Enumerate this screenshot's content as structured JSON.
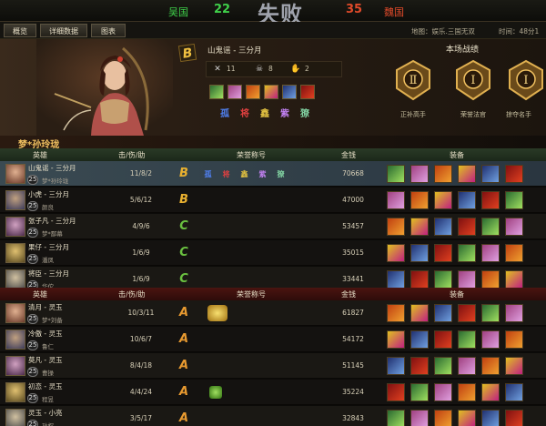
{
  "score": {
    "team_left": "吴国",
    "score_left": "22",
    "result_title": "失败",
    "score_right": "35",
    "team_right": "魏国"
  },
  "tabs": [
    "概览",
    "详细数据",
    "图表"
  ],
  "map_info": "地图：娱乐.三国无双",
  "time_info": "时间：48分1",
  "hero_banner": {
    "grade": "B",
    "hero_title": "山鬼谣 - 三分月",
    "kills": "11",
    "deaths": "8",
    "assists": "2",
    "honor_header": "本场战绩",
    "medals": [
      "正补高手",
      "荣誉法官",
      "掠夺名手"
    ]
  },
  "player_name": "梦*孙玲珑",
  "table_headers": {
    "hero": "英雄",
    "kda": "击/伤/助",
    "honor": "荣誉称号",
    "gold": "金钱",
    "items": "装备"
  },
  "team1": [
    {
      "hero": "山鬼谣 - 三分月",
      "level": "25",
      "player": "梦*孙玲珑",
      "kda": "11/8/2",
      "grade": "B",
      "gold": "70668",
      "selected": true
    },
    {
      "hero": "小虎 - 三分月",
      "level": "25",
      "player": "颜良",
      "kda": "5/6/12",
      "grade": "B",
      "gold": "47000"
    },
    {
      "hero": "张子凡 - 三分月",
      "level": "25",
      "player": "梦*鄙幕",
      "kda": "4/9/6",
      "grade": "C",
      "gold": "53457"
    },
    {
      "hero": "果仔 - 三分月",
      "level": "25",
      "player": "潘凤",
      "kda": "1/6/9",
      "grade": "C",
      "gold": "35015"
    },
    {
      "hero": "将臣 - 三分月",
      "level": "25",
      "player": "华佗",
      "kda": "1/6/9",
      "grade": "C",
      "gold": "33441"
    }
  ],
  "team2": [
    {
      "hero": "清月 - 灵玉",
      "level": "25",
      "player": "梦*刘备",
      "kda": "10/3/11",
      "grade": "A",
      "gold": "61827"
    },
    {
      "hero": "冷傲 - 灵玉",
      "level": "25",
      "player": "鲁仁",
      "kda": "10/6/7",
      "grade": "A",
      "gold": "54172"
    },
    {
      "hero": "莫凡 - 灵玉",
      "level": "25",
      "player": "曹操",
      "kda": "8/4/18",
      "grade": "A",
      "gold": "51145"
    },
    {
      "hero": "初恋 - 灵玉",
      "level": "25",
      "player": "程昱",
      "kda": "4/4/24",
      "grade": "A",
      "gold": "35224"
    },
    {
      "hero": "灵玉 - 小亮",
      "level": "25",
      "player": "孙权",
      "kda": "3/5/17",
      "grade": "A",
      "gold": "32843"
    }
  ],
  "honor_glyphs": [
    "孤",
    "将",
    "鑫",
    "紫",
    "獠"
  ],
  "colors": {
    "team_left": "#3fd04a",
    "team_right": "#e04a2a",
    "gold_text": "#f0c060"
  }
}
